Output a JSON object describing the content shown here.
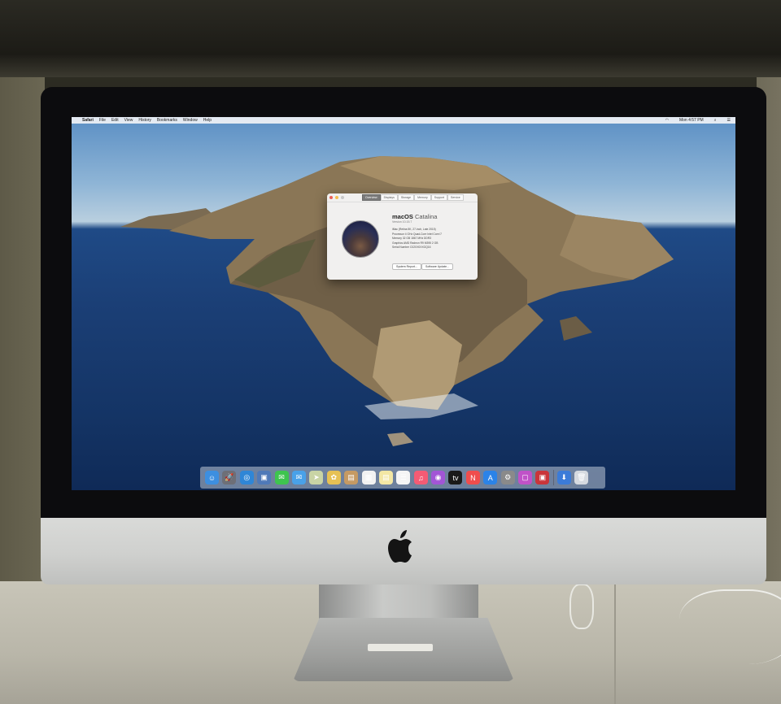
{
  "menubar": {
    "app": "Safari",
    "items": [
      "File",
      "Edit",
      "View",
      "History",
      "Bookmarks",
      "Window",
      "Help"
    ],
    "clock": "Mon 4:57 PM"
  },
  "about": {
    "tabs": [
      "Overview",
      "Displays",
      "Storage",
      "Memory",
      "Support",
      "Service"
    ],
    "name_bold": "macOS",
    "name_light": "Catalina",
    "version": "Version 10.15.7",
    "specs": [
      "iMac (Retina 5K, 27-inch, Late 2015)",
      "Processor  4 GHz Quad-Core Intel Core i7",
      "Memory  32 GB 1867 MHz DDR3",
      "Graphics  AMD Radeon R9 M395 2 GB",
      "Serial Number  C02XX0XXGQ16"
    ],
    "buttons": [
      "System Report...",
      "Software Update..."
    ]
  },
  "dock": {
    "icons": [
      {
        "name": "finder-icon",
        "color": "#3d8fe0",
        "glyph": "☺"
      },
      {
        "name": "launchpad-icon",
        "color": "#6d6f77",
        "glyph": "🚀"
      },
      {
        "name": "safari-icon",
        "color": "#2f86d6",
        "glyph": "◎"
      },
      {
        "name": "photos-browser-icon",
        "color": "#4f79b8",
        "glyph": "▣"
      },
      {
        "name": "messages-icon",
        "color": "#3ec44f",
        "glyph": "✉"
      },
      {
        "name": "mail-icon",
        "color": "#49a1e8",
        "glyph": "✉"
      },
      {
        "name": "maps-icon",
        "color": "#c9d4a5",
        "glyph": "➤"
      },
      {
        "name": "photos-icon",
        "color": "#e6c154",
        "glyph": "✿"
      },
      {
        "name": "contacts-icon",
        "color": "#c59a63",
        "glyph": "▤"
      },
      {
        "name": "calendar-icon",
        "color": "#f2f2f2",
        "glyph": "▦"
      },
      {
        "name": "notes-icon",
        "color": "#f3e7a4",
        "glyph": "▤"
      },
      {
        "name": "reminders-icon",
        "color": "#f5f5f5",
        "glyph": "☰"
      },
      {
        "name": "music-icon",
        "color": "#f45b74",
        "glyph": "♫"
      },
      {
        "name": "podcasts-icon",
        "color": "#a255d6",
        "glyph": "◉"
      },
      {
        "name": "apple-tv-icon",
        "color": "#1a1a1a",
        "glyph": "tv"
      },
      {
        "name": "news-icon",
        "color": "#f04d4d",
        "glyph": "N"
      },
      {
        "name": "app-store-icon",
        "color": "#2b83e8",
        "glyph": "A"
      },
      {
        "name": "system-preferences-icon",
        "color": "#8a8a8a",
        "glyph": "⚙"
      },
      {
        "name": "screen-time-icon",
        "color": "#c052c8",
        "glyph": "▢"
      },
      {
        "name": "photo-booth-icon",
        "color": "#c9353a",
        "glyph": "▣"
      },
      {
        "name": "downloads-icon",
        "color": "#3b7bd8",
        "glyph": "⬇"
      },
      {
        "name": "trash-icon",
        "color": "#d6dae0",
        "glyph": "🗑"
      }
    ]
  }
}
